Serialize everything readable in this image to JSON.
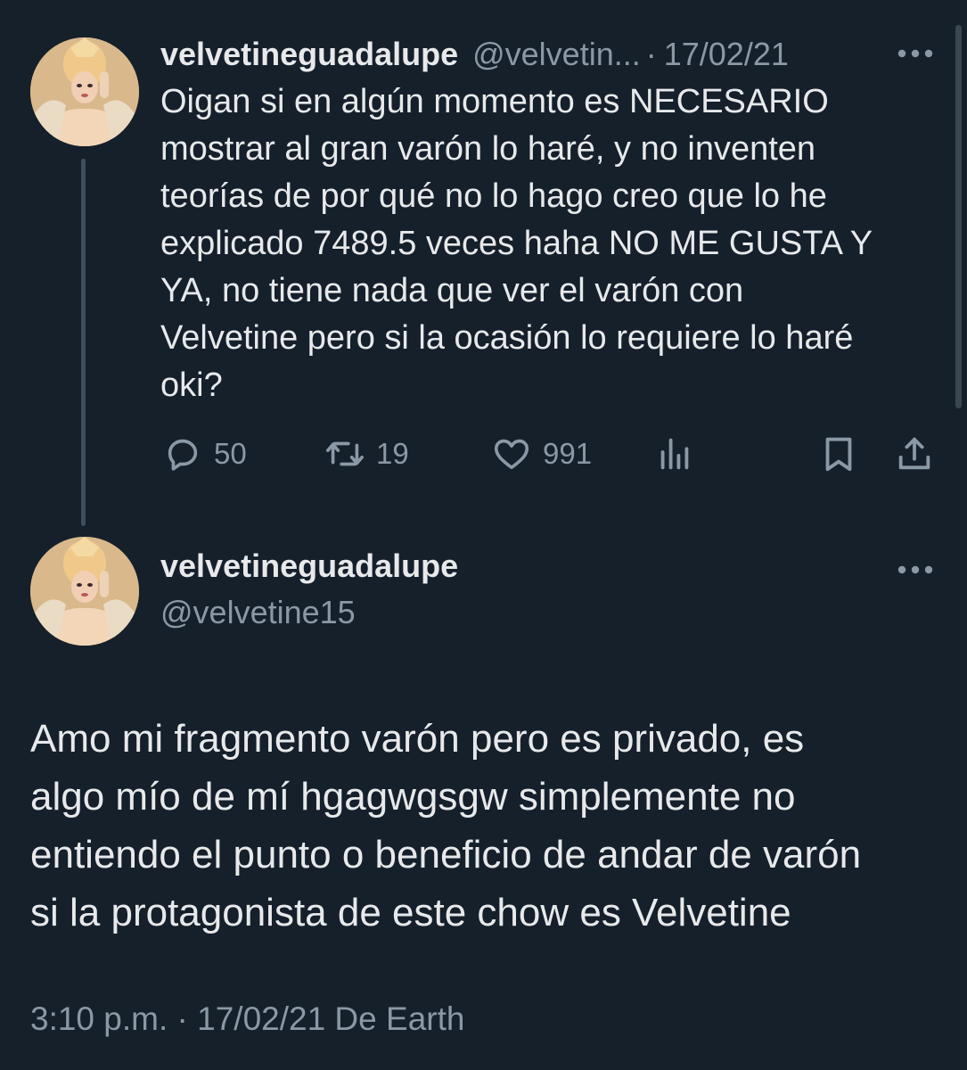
{
  "thread_tweet": {
    "display_name": "velvetineguadalupe",
    "handle": "@velvetin...",
    "separator": "·",
    "date": "17/02/21",
    "text": "Oigan si en algún momento es NECESARIO\nmostrar al gran varón lo haré, y no inventen\nteorías de por qué no lo hago creo que lo he\nexplicado 7489.5 veces haha NO ME GUSTA Y\nYA, no tiene nada que ver el varón con\nVelvetine pero si la ocasión lo requiere lo haré\noki?",
    "actions": {
      "replies": "50",
      "retweets": "19",
      "likes": "991"
    }
  },
  "main_tweet": {
    "display_name": "velvetineguadalupe",
    "handle": "@velvetine15",
    "text": "Amo mi fragmento varón pero es privado, es\nalgo mío de mí hgagwgsgw simplemente no\nentiendo el punto o beneficio de andar de varón\nsi la protagonista de este chow es Velvetine",
    "footer": "3:10 p.m. · 17/02/21 De Earth"
  },
  "icons": {
    "reply": "reply-icon",
    "retweet": "retweet-icon",
    "like": "heart-icon",
    "views": "views-icon",
    "bookmark": "bookmark-icon",
    "share": "share-icon",
    "more": "more-icon"
  },
  "colors": {
    "background": "#15202b",
    "text": "#e7e9ea",
    "muted": "#8b98a5",
    "thread_line": "#3d4f5e"
  }
}
